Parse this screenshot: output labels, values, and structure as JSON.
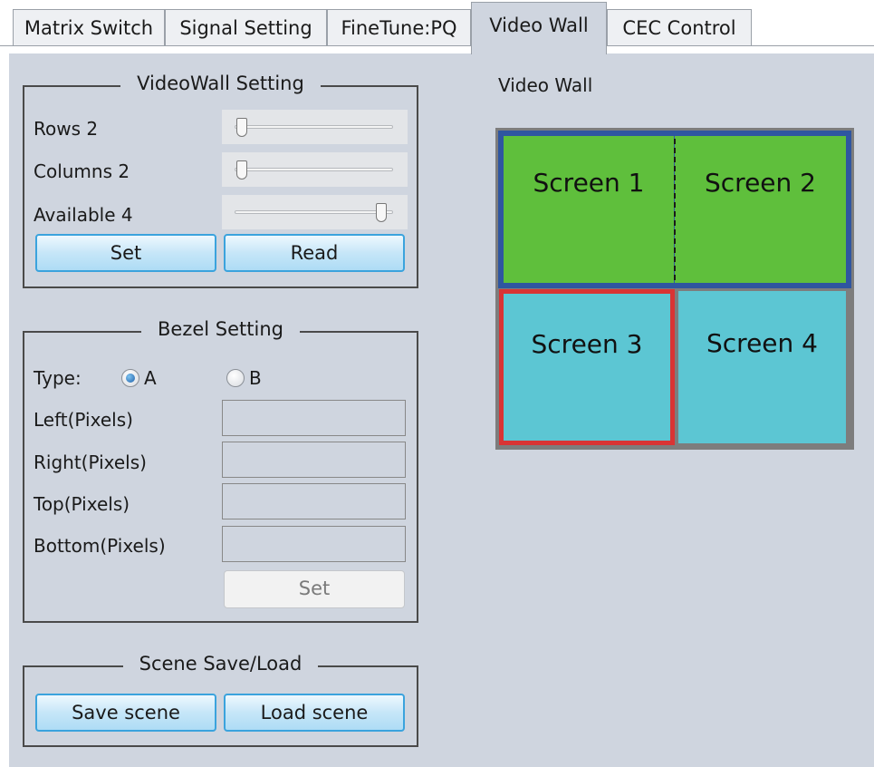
{
  "tabs": [
    {
      "label": "Matrix Switch"
    },
    {
      "label": "Signal Setting"
    },
    {
      "label": "FineTune:PQ"
    },
    {
      "label": "Video Wall"
    },
    {
      "label": "CEC Control"
    }
  ],
  "videowall_setting": {
    "title": "VideoWall Setting",
    "rows_label": "Rows 2",
    "rows_value": 2,
    "columns_label": "Columns 2",
    "columns_value": 2,
    "available_label": "Available 4",
    "available_value": 4,
    "set_label": "Set",
    "read_label": "Read"
  },
  "bezel_setting": {
    "title": "Bezel Setting",
    "type_label": "Type:",
    "option_a": "A",
    "option_b": "B",
    "selected": "A",
    "left_label": "Left(Pixels)",
    "right_label": "Right(Pixels)",
    "top_label": "Top(Pixels)",
    "bottom_label": "Bottom(Pixels)",
    "left_value": "",
    "right_value": "",
    "top_value": "",
    "bottom_value": "",
    "set_label": "Set"
  },
  "scene": {
    "title": "Scene Save/Load",
    "save_label": "Save scene",
    "load_label": "Load scene"
  },
  "video_wall": {
    "title": "Video Wall",
    "screens": [
      {
        "label": "Screen 1",
        "color": "#5fbf3c"
      },
      {
        "label": "Screen 2",
        "color": "#5fbf3c"
      },
      {
        "label": "Screen 3",
        "color": "#5cc6d3"
      },
      {
        "label": "Screen 4",
        "color": "#5cc6d3"
      }
    ],
    "group_border_color": "#2f56a0",
    "selected_border_color": "#d93434"
  },
  "colors": {
    "panel_bg": "#cfd5df",
    "button_border": "#3ba3dd"
  }
}
